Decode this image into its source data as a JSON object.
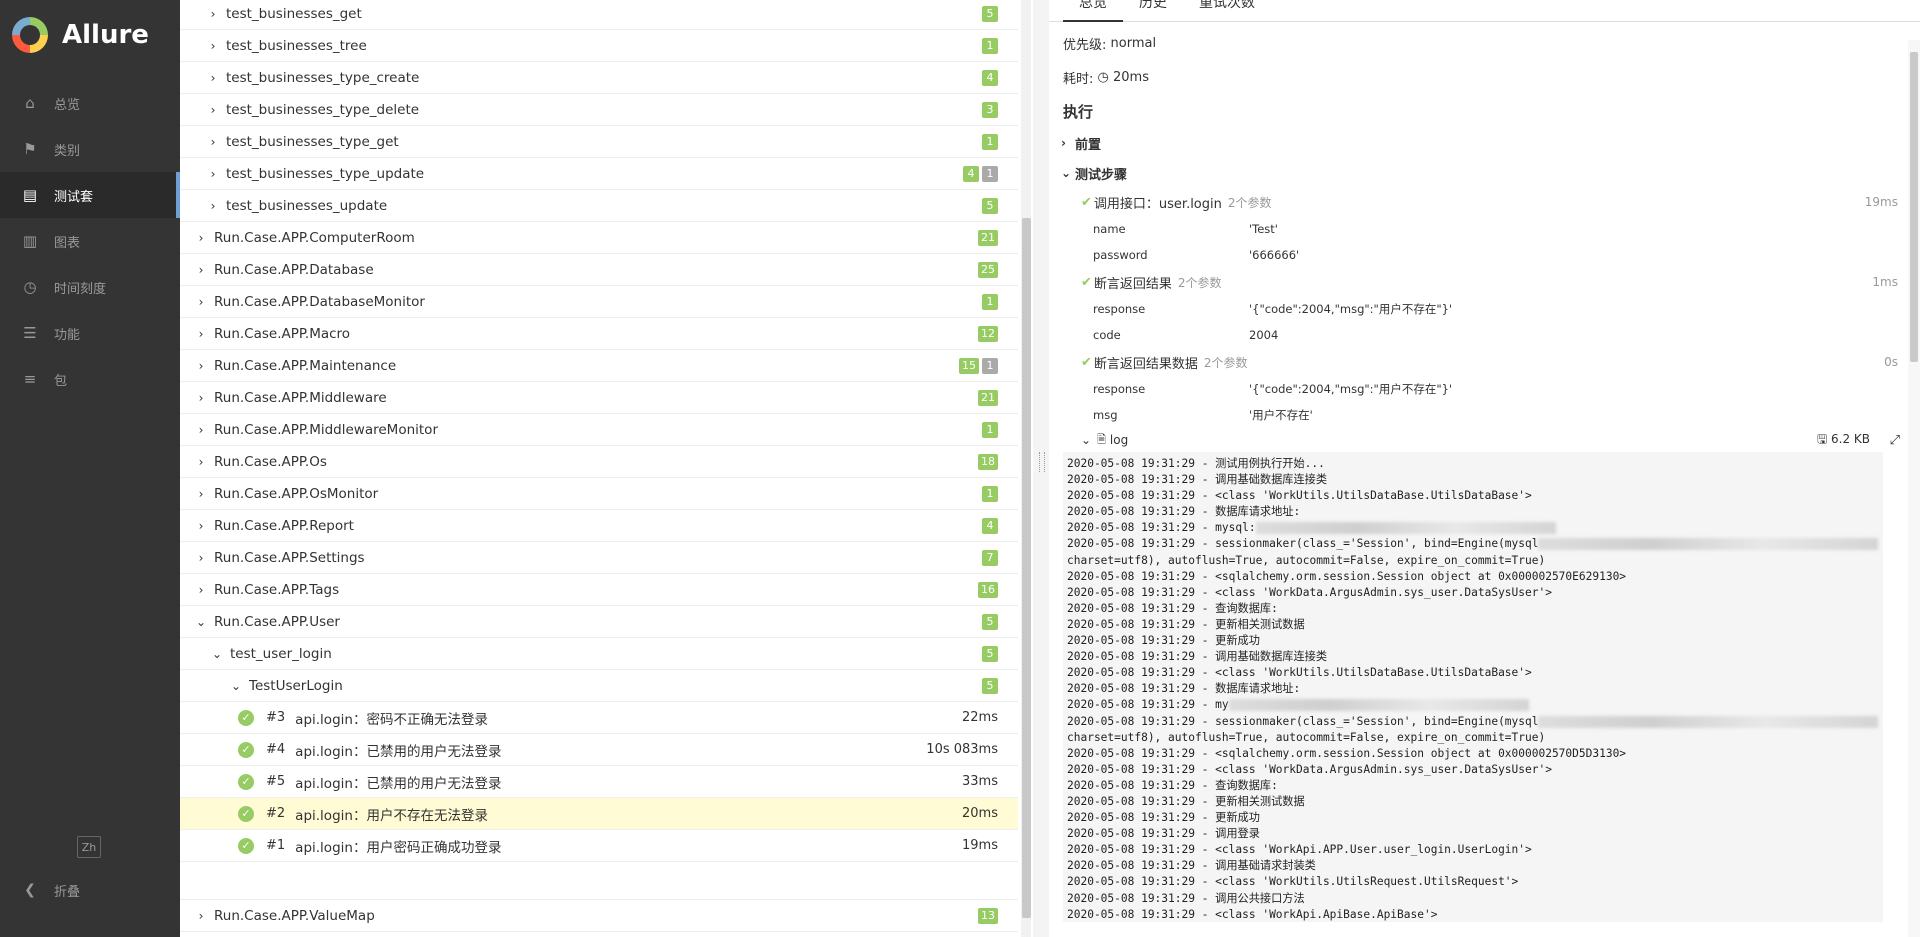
{
  "sidebar": {
    "brand": "Allure",
    "items": [
      {
        "label": "总览",
        "icon": "home-icon",
        "glyph": "⌂"
      },
      {
        "label": "类别",
        "icon": "flag-icon",
        "glyph": "⚑"
      },
      {
        "label": "测试套",
        "icon": "briefcase-icon",
        "glyph": "▤"
      },
      {
        "label": "图表",
        "icon": "bar-chart-icon",
        "glyph": "▥"
      },
      {
        "label": "时间刻度",
        "icon": "clock-icon",
        "glyph": "◷"
      },
      {
        "label": "功能",
        "icon": "list-icon",
        "glyph": "☰"
      },
      {
        "label": "包",
        "icon": "align-left-icon",
        "glyph": "≡"
      }
    ],
    "lang": "Zh",
    "collapse": "折叠"
  },
  "tree": {
    "top_children": [
      {
        "label": "test_businesses_get",
        "counts": [
          "5"
        ]
      },
      {
        "label": "test_businesses_tree",
        "counts": [
          "1"
        ]
      },
      {
        "label": "test_businesses_type_create",
        "counts": [
          "4"
        ]
      },
      {
        "label": "test_businesses_type_delete",
        "counts": [
          "3"
        ]
      },
      {
        "label": "test_businesses_type_get",
        "counts": [
          "1"
        ]
      },
      {
        "label": "test_businesses_type_update",
        "counts": [
          "4",
          "1"
        ]
      },
      {
        "label": "test_businesses_update",
        "counts": [
          "5"
        ]
      }
    ],
    "suites_a": [
      {
        "label": "Run.Case.APP.ComputerRoom",
        "counts": [
          "21"
        ]
      },
      {
        "label": "Run.Case.APP.Database",
        "counts": [
          "25"
        ]
      },
      {
        "label": "Run.Case.APP.DatabaseMonitor",
        "counts": [
          "1"
        ]
      },
      {
        "label": "Run.Case.APP.Macro",
        "counts": [
          "12"
        ]
      },
      {
        "label": "Run.Case.APP.Maintenance",
        "counts": [
          "15",
          "1"
        ]
      },
      {
        "label": "Run.Case.APP.Middleware",
        "counts": [
          "21"
        ]
      },
      {
        "label": "Run.Case.APP.MiddlewareMonitor",
        "counts": [
          "1"
        ]
      },
      {
        "label": "Run.Case.APP.Os",
        "counts": [
          "18"
        ]
      },
      {
        "label": "Run.Case.APP.OsMonitor",
        "counts": [
          "1"
        ]
      },
      {
        "label": "Run.Case.APP.Report",
        "counts": [
          "4"
        ]
      },
      {
        "label": "Run.Case.APP.Settings",
        "counts": [
          "7"
        ]
      },
      {
        "label": "Run.Case.APP.Tags",
        "counts": [
          "16"
        ]
      }
    ],
    "user_suite": {
      "label": "Run.Case.APP.User",
      "count": "5"
    },
    "user_module": {
      "label": "test_user_login",
      "count": "5"
    },
    "user_class": {
      "label": "TestUserLogin",
      "count": "5"
    },
    "tests": [
      {
        "num": "#3",
        "label": "api.login：密码不正确无法登录",
        "dur": "22ms"
      },
      {
        "num": "#4",
        "label": "api.login：已禁用的用户无法登录",
        "dur": "10s 083ms"
      },
      {
        "num": "#5",
        "label": "api.login：已禁用的用户无法登录",
        "dur": "33ms"
      },
      {
        "num": "#2",
        "label": "api.login：用户不存在无法登录",
        "dur": "20ms"
      },
      {
        "num": "#1",
        "label": "api.login：用户密码正确成功登录",
        "dur": "19ms"
      }
    ],
    "last_suite": {
      "label": "Run.Case.APP.ValueMap",
      "count": "13"
    }
  },
  "detail": {
    "tabs": [
      "总览",
      "历史",
      "重试次数"
    ],
    "priority_label": "优先级:",
    "priority_value": "normal",
    "duration_label": "耗时:",
    "duration_value": "20ms",
    "exec_title": "执行",
    "setup_label": "前置",
    "steps_label": "测试步骤",
    "steps": [
      {
        "name": "调用接口：user.login",
        "params": "2个参数",
        "dur": "19ms",
        "rows": [
          {
            "k": "name",
            "v": "'Test'"
          },
          {
            "k": "password",
            "v": "'666666'"
          }
        ]
      },
      {
        "name": "断言返回结果",
        "params": "2个参数",
        "dur": "1ms",
        "rows": [
          {
            "k": "response",
            "v": "'{\"code\":2004,\"msg\":\"用户不存在\"}'"
          },
          {
            "k": "code",
            "v": "2004"
          }
        ]
      },
      {
        "name": "断言返回结果数据",
        "params": "2个参数",
        "dur": "0s",
        "rows": [
          {
            "k": "response",
            "v": "'{\"code\":2004,\"msg\":\"用户不存在\"}'"
          },
          {
            "k": "msg",
            "v": "'用户不存在'"
          }
        ]
      }
    ],
    "log_label": "log",
    "log_size": "6.2 KB",
    "log_lines": [
      "2020-05-08 19:31:29 - 测试用例执行开始...",
      "2020-05-08 19:31:29 - 调用基础数据库连接类",
      "2020-05-08 19:31:29 - <class 'WorkUtils.UtilsDataBase.UtilsDataBase'>",
      "2020-05-08 19:31:29 - 数据库请求地址:",
      "2020-05-08 19:31:29 - mysql:",
      "2020-05-08 19:31:29 - sessionmaker(class_='Session', bind=Engine(mysql",
      "charset=utf8), autoflush=True, autocommit=False, expire_on_commit=True)",
      "2020-05-08 19:31:29 - <sqlalchemy.orm.session.Session object at 0x000002570E629130>",
      "2020-05-08 19:31:29 - <class 'WorkData.ArgusAdmin.sys_user.DataSysUser'>",
      "2020-05-08 19:31:29 - 查询数据库:",
      "2020-05-08 19:31:29 - 更新相关测试数据",
      "2020-05-08 19:31:29 - 更新成功",
      "2020-05-08 19:31:29 - 调用基础数据库连接类",
      "2020-05-08 19:31:29 - <class 'WorkUtils.UtilsDataBase.UtilsDataBase'>",
      "2020-05-08 19:31:29 - 数据库请求地址:",
      "2020-05-08 19:31:29 - my",
      "2020-05-08 19:31:29 - sessionmaker(class_='Session', bind=Engine(mysql",
      "charset=utf8), autoflush=True, autocommit=False, expire_on_commit=True)",
      "2020-05-08 19:31:29 - <sqlalchemy.orm.session.Session object at 0x000002570D5D3130>",
      "2020-05-08 19:31:29 - <class 'WorkData.ArgusAdmin.sys_user.DataSysUser'>",
      "2020-05-08 19:31:29 - 查询数据库:",
      "2020-05-08 19:31:29 - 更新相关测试数据",
      "2020-05-08 19:31:29 - 更新成功",
      "2020-05-08 19:31:29 - 调用登录",
      "2020-05-08 19:31:29 - <class 'WorkApi.APP.User.user_login.UserLogin'>",
      "2020-05-08 19:31:29 - 调用基础请求封装类",
      "2020-05-08 19:31:29 - <class 'WorkUtils.UtilsRequest.UtilsRequest'>",
      "2020-05-08 19:31:29 - 调用公共接口方法",
      "2020-05-08 19:31:29 - <class 'WorkApi.ApiBase.ApiBase'>"
    ]
  }
}
